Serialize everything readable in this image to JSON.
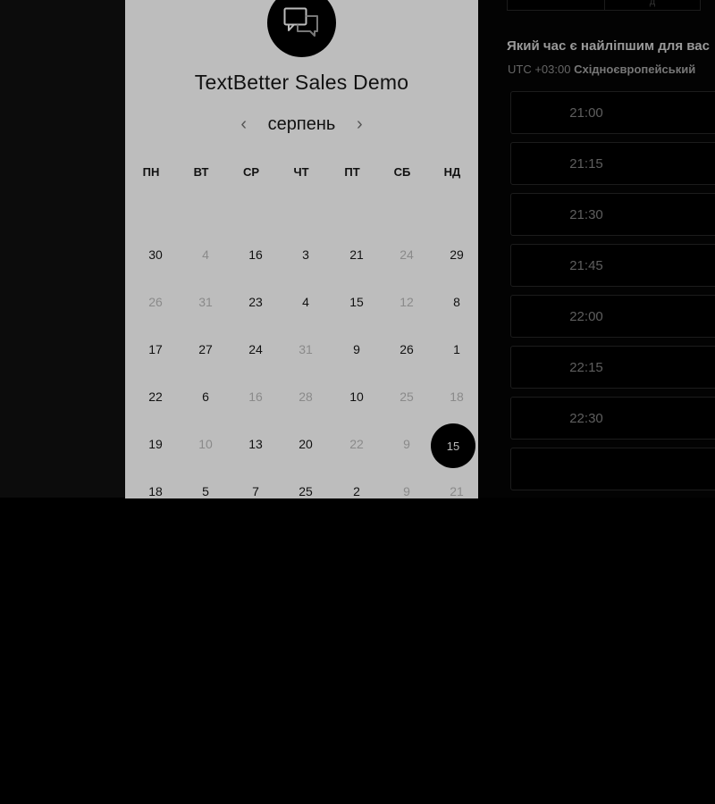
{
  "app": {
    "title": "TextBetter Sales Demo",
    "logo_icon": "chat-bubbles-icon"
  },
  "calendar": {
    "month": "серпень",
    "prev_icon": "chevron-left-icon",
    "next_icon": "chevron-right-icon",
    "weekdays": [
      "ПН",
      "ВТ",
      "СР",
      "ЧТ",
      "ПТ",
      "СБ",
      "НД"
    ],
    "weeks": [
      [
        {
          "d": "30",
          "dim": false
        },
        {
          "d": "4",
          "dim": true
        },
        {
          "d": "16",
          "dim": false
        },
        {
          "d": "3",
          "dim": false
        },
        {
          "d": "21",
          "dim": false
        },
        {
          "d": "24",
          "dim": true
        },
        {
          "d": "29",
          "dim": false
        }
      ],
      [
        {
          "d": "26",
          "dim": true
        },
        {
          "d": "31",
          "dim": true
        },
        {
          "d": "23",
          "dim": false
        },
        {
          "d": "4",
          "dim": false
        },
        {
          "d": "15",
          "dim": false
        },
        {
          "d": "12",
          "dim": true
        },
        {
          "d": "8",
          "dim": false
        }
      ],
      [
        {
          "d": "17",
          "dim": false
        },
        {
          "d": "27",
          "dim": false
        },
        {
          "d": "24",
          "dim": false
        },
        {
          "d": "31",
          "dim": true
        },
        {
          "d": "9",
          "dim": false
        },
        {
          "d": "26",
          "dim": false
        },
        {
          "d": "1",
          "dim": false
        }
      ],
      [
        {
          "d": "22",
          "dim": false
        },
        {
          "d": "6",
          "dim": false
        },
        {
          "d": "16",
          "dim": true
        },
        {
          "d": "28",
          "dim": true
        },
        {
          "d": "10",
          "dim": false
        },
        {
          "d": "25",
          "dim": true
        },
        {
          "d": "18",
          "dim": true
        }
      ],
      [
        {
          "d": "19",
          "dim": false
        },
        {
          "d": "10",
          "dim": true
        },
        {
          "d": "13",
          "dim": false
        },
        {
          "d": "20",
          "dim": false
        },
        {
          "d": "22",
          "dim": true
        },
        {
          "d": "9",
          "dim": true
        },
        {
          "d": "15",
          "dim": false,
          "selected": true
        }
      ],
      [
        {
          "d": "18",
          "dim": false
        },
        {
          "d": "5",
          "dim": false
        },
        {
          "d": "7",
          "dim": false
        },
        {
          "d": "25",
          "dim": false
        },
        {
          "d": "2",
          "dim": false
        },
        {
          "d": "9",
          "dim": true
        },
        {
          "d": "21",
          "dim": true
        }
      ]
    ]
  },
  "times": {
    "heading": "Який час є найліпшим для вас",
    "timezone_offset": "UTC +03:00",
    "timezone_name": "Східноєвропейський",
    "top_fragment": "д",
    "slots": [
      "21:00",
      "21:15",
      "21:30",
      "21:45",
      "22:00",
      "22:15",
      "22:30",
      ""
    ]
  },
  "colors": {
    "panel": "#bdbdbd",
    "selected": "#000000",
    "overlay": "#000000"
  }
}
